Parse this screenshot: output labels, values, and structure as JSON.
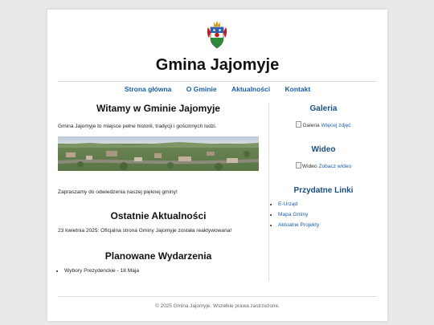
{
  "header": {
    "title": "Gmina Jajomyje",
    "crest_icon": "coat-of-arms-icon"
  },
  "nav": {
    "items": [
      "Strona główna",
      "O Gminie",
      "Aktualności",
      "Kontakt"
    ]
  },
  "welcome": {
    "heading": "Witamy w Gminie Jajomyje",
    "intro": "Gmina Jajomyje to miejsce pełne historii, tradycji i gościnnych ludzi.",
    "outro": "Zapraszamy do odwiedzenia naszej pięknej gminy!"
  },
  "news": {
    "heading": "Ostatnie Aktualności",
    "item": "23 kwietnia 2025: Oficjalna strona Gminy Jajomyje została reaktywowana!"
  },
  "events": {
    "heading": "Planowane Wydarzenia",
    "items": [
      "Wybory Prezydenckie - 18 Maja"
    ]
  },
  "sidebar": {
    "gallery": {
      "heading": "Galeria",
      "img_alt": "Galeria",
      "link": "Więcej zdjęć"
    },
    "video": {
      "heading": "Wideo",
      "img_alt": "Wideo",
      "link": "Zobacz wideo"
    },
    "links": {
      "heading": "Przydatne Linki",
      "items": [
        "E-Urząd",
        "Mapa Gminy",
        "Aktualne Projekty"
      ]
    }
  },
  "footer": {
    "text": "© 2025 Gmina Jajomyje. Wszelkie prawa zastrzeżone."
  },
  "colors": {
    "accent": "#1a5ea8",
    "heading_side": "#1a4e82",
    "page_bg": "#e9e9e9"
  }
}
